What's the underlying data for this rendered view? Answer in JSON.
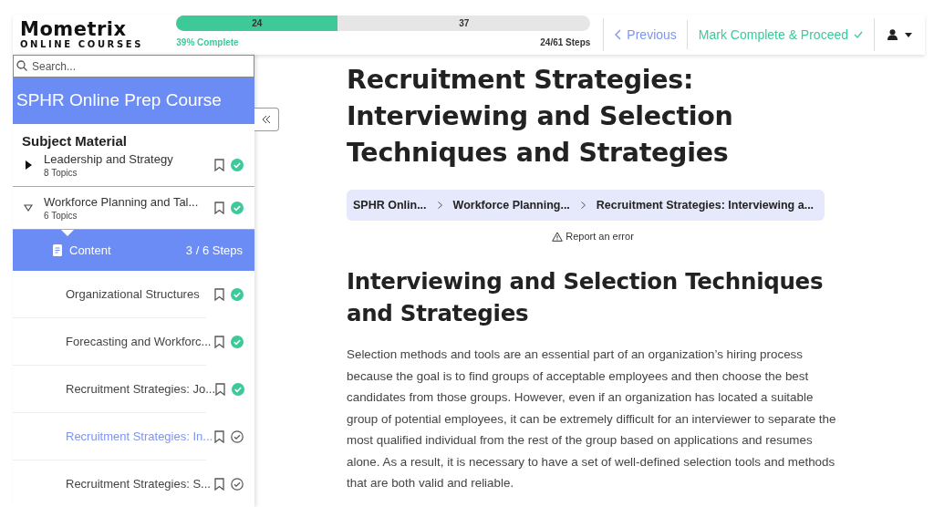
{
  "logo": {
    "name": "Mometrix",
    "tagline": "ONLINE COURSES"
  },
  "progress": {
    "level": 0.39,
    "done_label": "24",
    "remaining_label": "37",
    "percent_text": "39% Complete",
    "steps_text": "24/61 Steps"
  },
  "nav": {
    "previous": "Previous",
    "complete": "Mark Complete & Proceed"
  },
  "sidebar": {
    "search": {
      "placeholder": "Search..."
    },
    "course_title": "SPHR Online Prep Course",
    "section_title": "Subject Material",
    "lessons": [
      {
        "title": "Leadership and Strategy",
        "topics_count": "8 Topics",
        "expanded": false,
        "complete": true
      },
      {
        "title": "Workforce Planning and Tal...",
        "topics_count": "6 Topics",
        "expanded": true,
        "complete": true,
        "content": {
          "label": "Content",
          "steps": "3 / 6 Steps"
        },
        "children": [
          {
            "title": "Organizational Structures",
            "complete": true,
            "selected": false
          },
          {
            "title": "Forecasting and Workforc...",
            "complete": true,
            "selected": false
          },
          {
            "title": "Recruitment Strategies: Jo...",
            "complete": true,
            "selected": false
          },
          {
            "title": "Recruitment Strategies: In...",
            "complete": false,
            "selected": true
          },
          {
            "title": "Recruitment Strategies: S...",
            "complete": false,
            "selected": false
          }
        ]
      }
    ]
  },
  "main": {
    "title": "Recruitment Strategies: Interviewing and Selection Techniques and Strategies",
    "breadcrumbs": [
      "SPHR Onlin...",
      "Workforce Planning...",
      "Recruitment Strategies: Interviewing a..."
    ],
    "report": "Report an error",
    "heading": "Interviewing and Selection Techniques and Strategies",
    "paragraph": "Selection methods and tools are an essential part of an organization’s hiring process because the goal is to find groups of acceptable employees and then choose the best candidates from those groups. However, even if an organization has located a suitable group of potential employees, it can be extremely difficult for an interviewer to separate the most qualified individual from the rest of the group based on applications and resumes alone. As a result, it is necessary to have a set of well-defined selection tools and methods that are both valid and reliable."
  }
}
